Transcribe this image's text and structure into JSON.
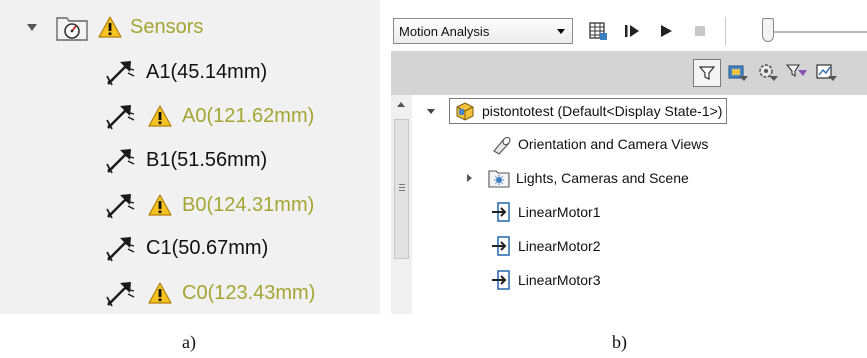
{
  "panel_a": {
    "sensors_label": "Sensors",
    "sensors": [
      {
        "label": "A1(45.14mm)",
        "warning": false
      },
      {
        "label": "A0(121.62mm)",
        "warning": true
      },
      {
        "label": "B1(51.56mm)",
        "warning": false
      },
      {
        "label": "B0(124.31mm)",
        "warning": true
      },
      {
        "label": "C1(50.67mm)",
        "warning": false
      },
      {
        "label": "C0(123.43mm)",
        "warning": true
      }
    ],
    "colors": {
      "warning_text": "#a5a534",
      "background": "#f1f1f1"
    }
  },
  "panel_b": {
    "study_type": "Motion Analysis",
    "toolbar_icons": [
      "calculator-icon",
      "step-forward-icon",
      "play-icon",
      "stop-icon",
      "timeline-slider"
    ],
    "filter_icons": [
      "filter-icon",
      "camera-filter-icon",
      "gear-filter-icon",
      "funnel-filter-icon",
      "results-filter-icon"
    ],
    "tree": {
      "root": "pistontotest  (Default<Display State-1>)",
      "items": [
        {
          "label": "Orientation and Camera Views",
          "icon": "camera-views-icon",
          "expandable": false
        },
        {
          "label": "Lights, Cameras and Scene",
          "icon": "lights-folder-icon",
          "expandable": true
        },
        {
          "label": "LinearMotor1",
          "icon": "linear-motor-icon",
          "expandable": false
        },
        {
          "label": "LinearMotor2",
          "icon": "linear-motor-icon",
          "expandable": false
        },
        {
          "label": "LinearMotor3",
          "icon": "linear-motor-icon",
          "expandable": false
        }
      ]
    }
  },
  "captions": {
    "a": "a)",
    "b": "b)"
  }
}
